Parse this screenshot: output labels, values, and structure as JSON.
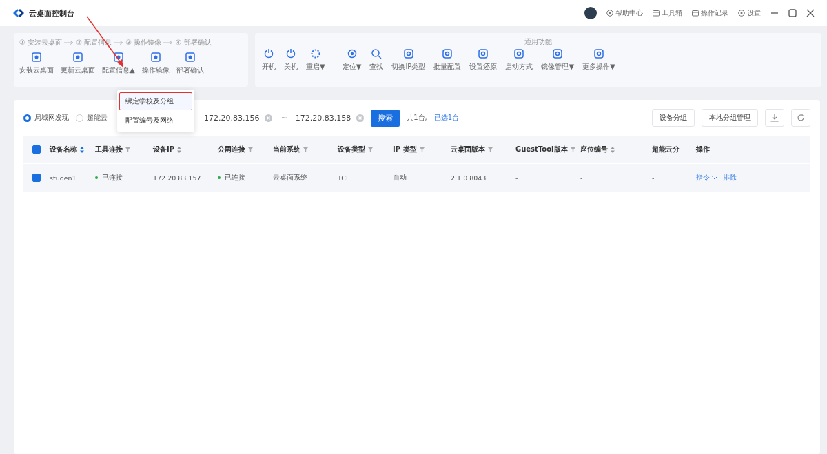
{
  "window": {
    "title": "云桌面控制台",
    "header_links": [
      "帮助中心",
      "工具箱",
      "操作记录",
      "设置"
    ]
  },
  "deploy": {
    "steps": [
      "① 安装云桌面",
      "② 配置信息",
      "③ 操作镜像",
      "④ 部署确认"
    ],
    "buttons": [
      {
        "label": "安装云桌面"
      },
      {
        "label": "更新云桌面"
      },
      {
        "label": "配置信息",
        "caret": "▲"
      },
      {
        "label": "操作镜像"
      },
      {
        "label": "部署确认"
      }
    ]
  },
  "common": {
    "title": "通用功能",
    "buttons": [
      {
        "label": "开机"
      },
      {
        "label": "关机"
      },
      {
        "label": "重启",
        "caret": "▼"
      },
      {
        "label": "定位",
        "caret": "▼"
      },
      {
        "label": "查找"
      },
      {
        "label": "切换IP类型"
      },
      {
        "label": "批量配置"
      },
      {
        "label": "设置还原"
      },
      {
        "label": "启动方式"
      },
      {
        "label": "镜像管理",
        "caret": "▼"
      },
      {
        "label": "更多操作",
        "caret": "▼"
      }
    ]
  },
  "dropdown": {
    "items": [
      {
        "label": "绑定学校及分组",
        "highlighted": true
      },
      {
        "label": "配置编号及网络",
        "highlighted": false
      }
    ]
  },
  "filter": {
    "modes": [
      {
        "label": "局域网发现",
        "selected": true
      },
      {
        "label": "超能云",
        "selected": false
      }
    ],
    "ip_from": "172.20.83.156",
    "separator": "~",
    "ip_to": "172.20.83.158",
    "search": "搜索",
    "total": "共1台,",
    "selected_count": "已选1台",
    "buttons": [
      "设备分组",
      "本地分组管理"
    ]
  },
  "table": {
    "all_checked": true,
    "columns": [
      {
        "label": "设备名称",
        "sortable": true,
        "filterable": false
      },
      {
        "label": "工具连接",
        "sortable": false,
        "filterable": true
      },
      {
        "label": "设备IP",
        "sortable": true,
        "filterable": false
      },
      {
        "label": "公网连接",
        "sortable": false,
        "filterable": true
      },
      {
        "label": "当前系统",
        "sortable": false,
        "filterable": true
      },
      {
        "label": "设备类型",
        "sortable": false,
        "filterable": true
      },
      {
        "label": "IP 类型",
        "sortable": false,
        "filterable": true
      },
      {
        "label": "云桌面版本",
        "sortable": false,
        "filterable": true
      },
      {
        "label": "GuestTool版本",
        "sortable": false,
        "filterable": true
      },
      {
        "label": "座位编号",
        "sortable": true,
        "filterable": false
      },
      {
        "label": "超能云分",
        "sortable": false,
        "filterable": false
      },
      {
        "label": "操作",
        "sortable": false,
        "filterable": false
      }
    ],
    "rows": [
      {
        "checked": true,
        "cells": [
          "studen1",
          "已连接",
          "172.20.83.157",
          "已连接",
          "云桌面系统",
          "TCI",
          "自动",
          "2.1.0.8043",
          "-",
          "-",
          "-"
        ],
        "actions": [
          "指令",
          "排除"
        ]
      }
    ]
  }
}
